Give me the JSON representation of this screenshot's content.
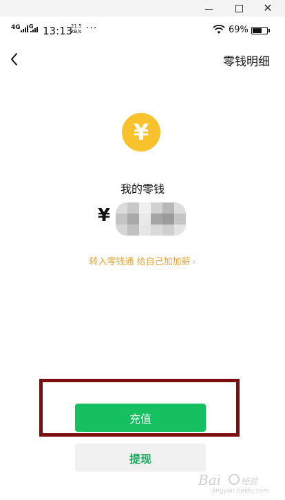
{
  "window_controls": {
    "minimize_icon": "minimize-icon",
    "maximize_icon": "maximize-icon",
    "close_label": "✕"
  },
  "status_bar": {
    "network_1": "4G",
    "network_2": "G",
    "time": "13:13",
    "speed_value": "21.5",
    "speed_unit": "KB/s",
    "more": "···",
    "battery_percent": "69%",
    "battery_level": 0.69
  },
  "nav": {
    "back_icon": "chevron-left-icon",
    "title": "零钱明细"
  },
  "wallet": {
    "coin_symbol": "¥",
    "balance_label": "我的零钱",
    "currency_symbol": "¥",
    "promo_text": "转入零钱通 给自己加加薪",
    "promo_chevron": "›"
  },
  "actions": {
    "recharge_label": "充值",
    "withdraw_label": "提现"
  },
  "watermark": {
    "url": "jingyan.baidu.com"
  },
  "colors": {
    "accent_green": "#15c060",
    "coin_yellow": "#f7c22b",
    "promo_orange": "#e2a332",
    "highlight_frame": "#7d0e0e"
  }
}
